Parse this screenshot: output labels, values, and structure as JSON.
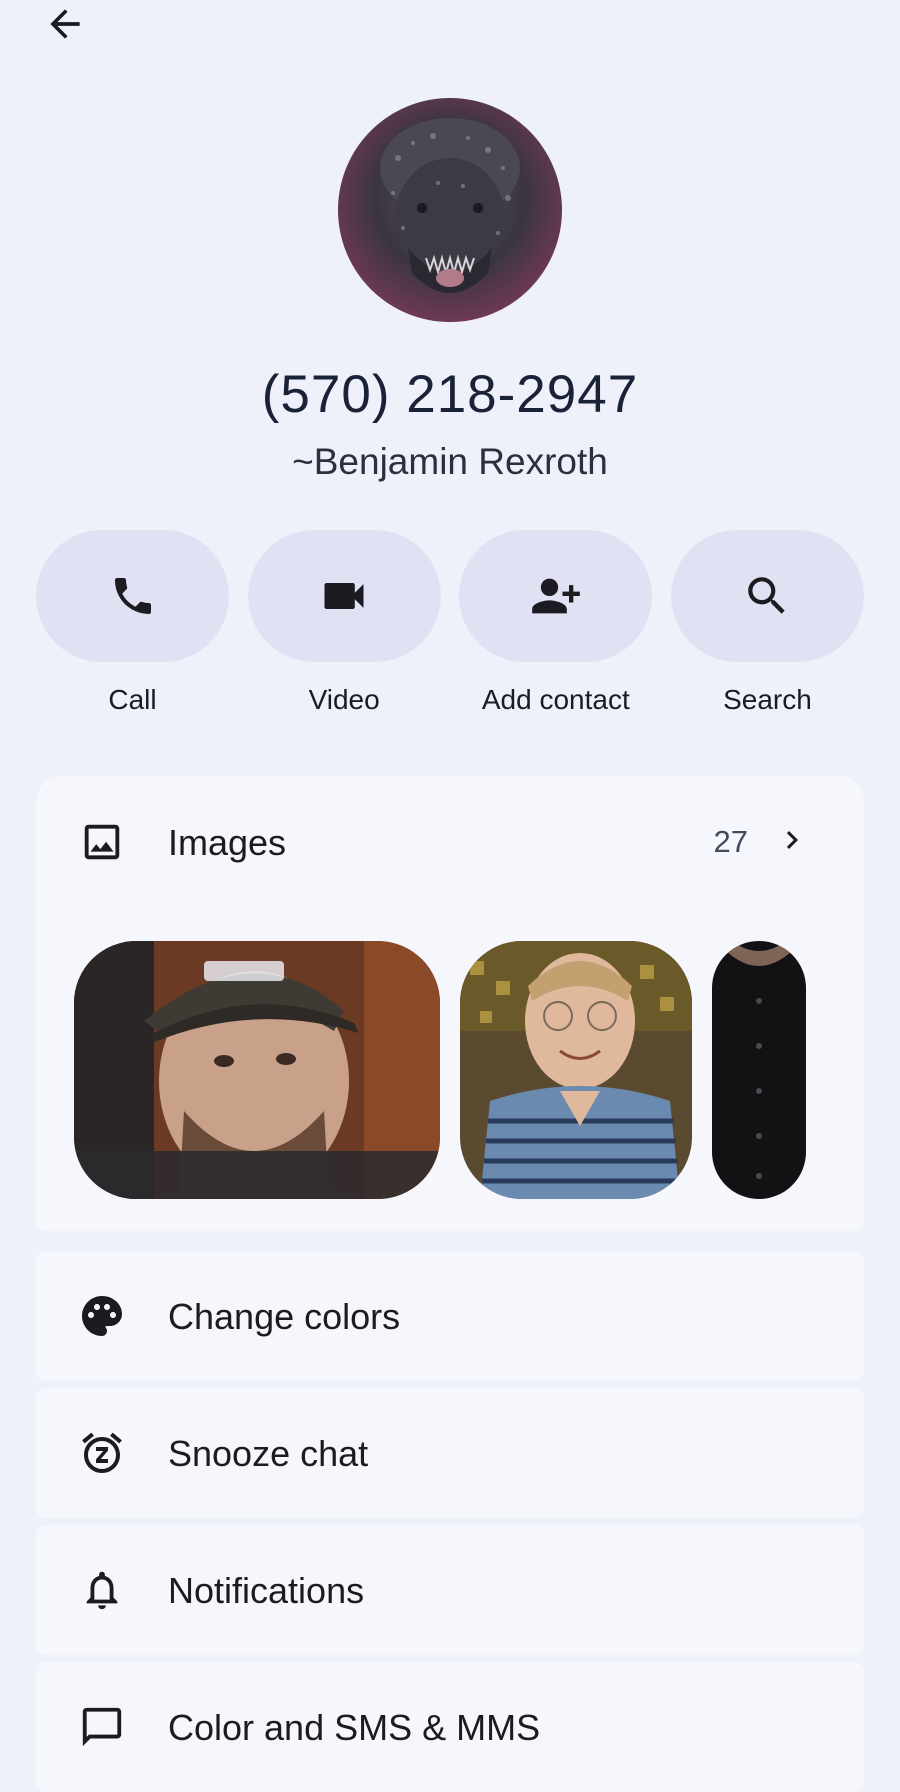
{
  "header": {
    "back_icon": "arrow-back-icon"
  },
  "contact": {
    "phone": "(570) 218-2947",
    "name": "~Benjamin Rexroth",
    "avatar": "profile-photo"
  },
  "actions": [
    {
      "label": "Call",
      "icon": "phone-icon"
    },
    {
      "label": "Video",
      "icon": "videocam-icon"
    },
    {
      "label": "Add contact",
      "icon": "person-add-icon"
    },
    {
      "label": "Search",
      "icon": "search-icon"
    }
  ],
  "images": {
    "label": "Images",
    "count": "27",
    "icon": "image-icon",
    "chevron": "chevron-right-icon"
  },
  "menu": [
    {
      "label": "Change colors",
      "icon": "palette-icon"
    },
    {
      "label": "Snooze chat",
      "icon": "snooze-alarm-icon"
    },
    {
      "label": "Notifications",
      "icon": "bell-icon"
    },
    {
      "label": "Color and SMS & MMS",
      "icon": "sms-icon"
    }
  ],
  "colors": {
    "background": "#eff1fa",
    "pill": "#e0e2f3",
    "card": "#f6f7fd",
    "text": "#1b1b21"
  }
}
